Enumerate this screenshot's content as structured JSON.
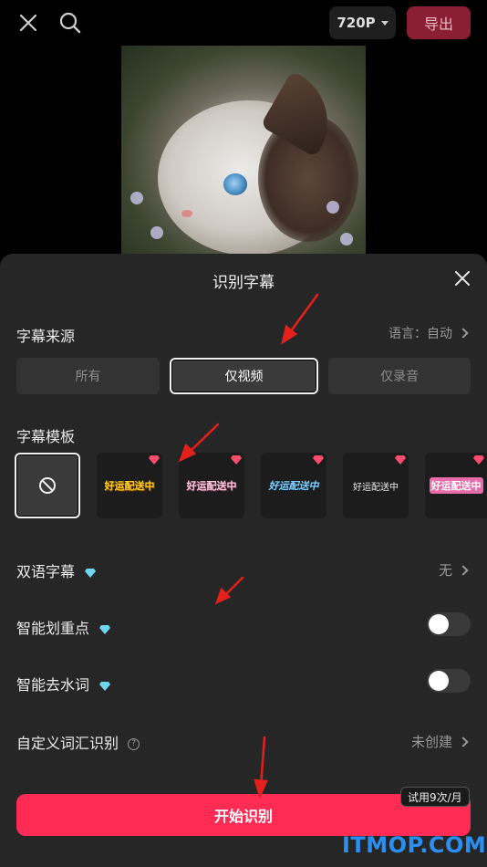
{
  "topbar": {
    "resolution_label": "720P",
    "export_label": "导出"
  },
  "sheet": {
    "title": "识别字幕",
    "source": {
      "label": "字幕来源",
      "language_label": "语言：自动",
      "options": [
        "所有",
        "仅视频",
        "仅录音"
      ],
      "selected": "仅视频"
    },
    "templates": {
      "label": "字幕模板",
      "items": [
        {
          "text": "",
          "color": "#ffffff"
        },
        {
          "text": "好运配送中",
          "color": "#ffd21a"
        },
        {
          "text": "好运配送中",
          "color": "#ffc9e0"
        },
        {
          "text": "好运配送中",
          "color": "#7fd0ff"
        },
        {
          "text": "好运配送中",
          "color": "#e8e8e8"
        },
        {
          "text": "好运配送中",
          "color": "#ffffff"
        }
      ]
    },
    "bilingual": {
      "label": "双语字幕",
      "value": "无"
    },
    "highlight": {
      "label": "智能划重点",
      "on": false
    },
    "filler": {
      "label": "智能去水词",
      "on": false
    },
    "custom_vocab": {
      "label": "自定义词汇识别",
      "value": "未创建"
    },
    "start_button": "开始识别",
    "trial_badge": "试用9次/月"
  },
  "watermark": "ITMOP.COM",
  "colors": {
    "accent": "#fe2c55",
    "sheet_bg": "#262626",
    "annotation_arrow": "#e3201c",
    "diamond": "#6fd6f0",
    "gem": "#ff4d6d"
  }
}
